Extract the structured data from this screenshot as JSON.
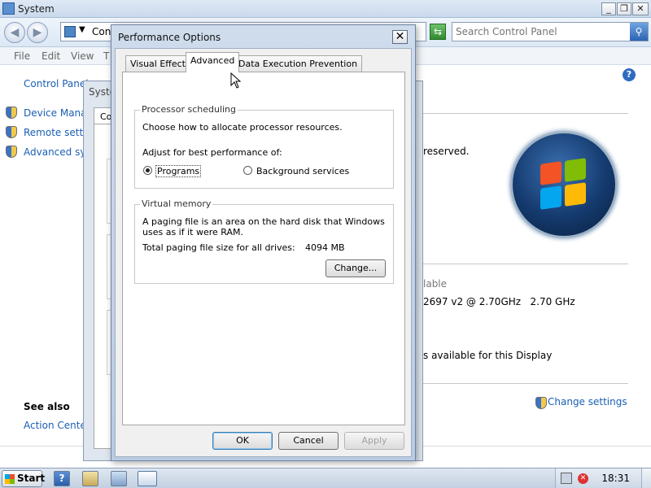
{
  "window": {
    "title": "System"
  },
  "address": {
    "crumb": "Con",
    "search_placeholder": "Search Control Panel"
  },
  "menu": [
    "File",
    "Edit",
    "View",
    "T"
  ],
  "left_nav": {
    "home": "Control Panel",
    "tasks": [
      "Device Manag",
      "Remote settir",
      "Advanced sys"
    ],
    "see_also_title": "See also",
    "see_also": [
      "Action Center"
    ]
  },
  "content": {
    "copyright_frag": "reserved.",
    "rating_frag": "lable",
    "processor_frag": "2697 v2 @ 2.70GHz   2.70 GHz",
    "pen_frag": "s available for this Display",
    "change_settings": "Change settings"
  },
  "sysprops": {
    "title_frag": "Syste",
    "tab_frag": "Co"
  },
  "dialog": {
    "title": "Performance Options",
    "tabs": [
      "Visual Effects",
      "Advanced",
      "Data Execution Prevention"
    ],
    "active_tab": "Advanced",
    "processor": {
      "legend": "Processor scheduling",
      "desc": "Choose how to allocate processor resources.",
      "adjust": "Adjust for best performance of:",
      "opt_programs": "Programs",
      "opt_background": "Background services",
      "selected": "Programs"
    },
    "vmem": {
      "legend": "Virtual memory",
      "desc": "A paging file is an area on the hard disk that Windows uses as if it were RAM.",
      "total_label": "Total paging file size for all drives:",
      "total_value": "4094 MB",
      "change": "Change..."
    },
    "ok": "OK",
    "cancel": "Cancel",
    "apply": "Apply"
  },
  "taskbar": {
    "start": "Start",
    "clock": "18:31"
  }
}
